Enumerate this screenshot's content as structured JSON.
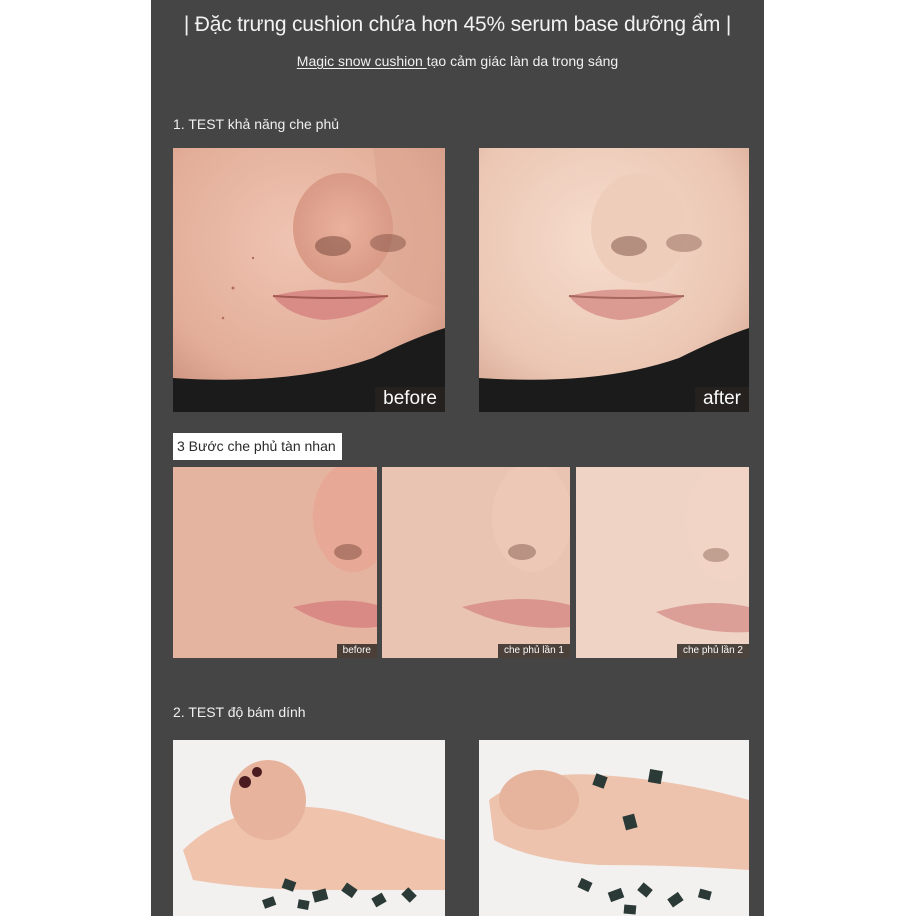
{
  "header": {
    "title": "| Đặc trưng cushion chứa hơn 45% serum base dưỡng ẩm |",
    "subtitle_underlined": "Magic snow cushion ",
    "subtitle_rest": "tạo cảm giác làn da trong sáng"
  },
  "section1": {
    "heading": "1. TEST khả năng che phủ",
    "photos": [
      {
        "tag": "before",
        "icon": "face-closeup-photo"
      },
      {
        "tag": "after",
        "icon": "face-closeup-photo"
      }
    ],
    "steps_label": "3 Bước che phủ tàn nhan",
    "steps": [
      {
        "tag": "before"
      },
      {
        "tag": "che phủ lần 1"
      },
      {
        "tag": "che phủ lần 2"
      }
    ]
  },
  "section2": {
    "heading": "2. TEST độ bám dính",
    "photos": [
      {
        "icon": "fist-with-confetti-photo"
      },
      {
        "icon": "hand-with-confetti-photo"
      }
    ]
  },
  "colors": {
    "panel_bg": "#454545",
    "skin_before": "#e6b5a2",
    "skin_after": "#efcdbd",
    "sweater": "#1c1c1c"
  }
}
